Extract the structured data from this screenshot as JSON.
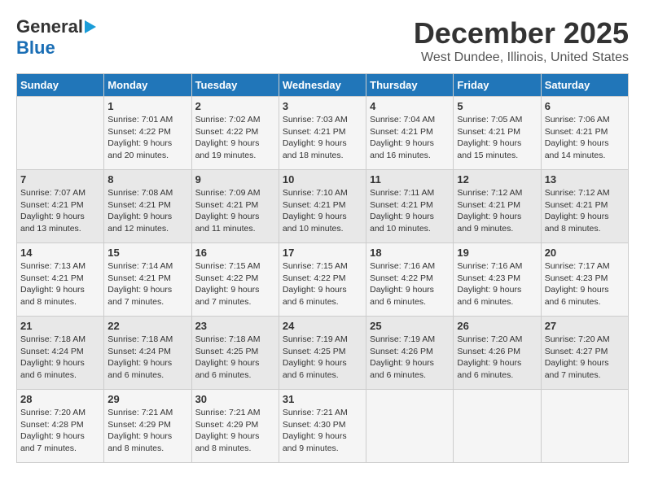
{
  "header": {
    "logo_general": "General",
    "logo_blue": "Blue",
    "month": "December 2025",
    "location": "West Dundee, Illinois, United States"
  },
  "weekdays": [
    "Sunday",
    "Monday",
    "Tuesday",
    "Wednesday",
    "Thursday",
    "Friday",
    "Saturday"
  ],
  "weeks": [
    [
      {
        "day": "",
        "info": ""
      },
      {
        "day": "1",
        "info": "Sunrise: 7:01 AM\nSunset: 4:22 PM\nDaylight: 9 hours\nand 20 minutes."
      },
      {
        "day": "2",
        "info": "Sunrise: 7:02 AM\nSunset: 4:22 PM\nDaylight: 9 hours\nand 19 minutes."
      },
      {
        "day": "3",
        "info": "Sunrise: 7:03 AM\nSunset: 4:21 PM\nDaylight: 9 hours\nand 18 minutes."
      },
      {
        "day": "4",
        "info": "Sunrise: 7:04 AM\nSunset: 4:21 PM\nDaylight: 9 hours\nand 16 minutes."
      },
      {
        "day": "5",
        "info": "Sunrise: 7:05 AM\nSunset: 4:21 PM\nDaylight: 9 hours\nand 15 minutes."
      },
      {
        "day": "6",
        "info": "Sunrise: 7:06 AM\nSunset: 4:21 PM\nDaylight: 9 hours\nand 14 minutes."
      }
    ],
    [
      {
        "day": "7",
        "info": "Sunrise: 7:07 AM\nSunset: 4:21 PM\nDaylight: 9 hours\nand 13 minutes."
      },
      {
        "day": "8",
        "info": "Sunrise: 7:08 AM\nSunset: 4:21 PM\nDaylight: 9 hours\nand 12 minutes."
      },
      {
        "day": "9",
        "info": "Sunrise: 7:09 AM\nSunset: 4:21 PM\nDaylight: 9 hours\nand 11 minutes."
      },
      {
        "day": "10",
        "info": "Sunrise: 7:10 AM\nSunset: 4:21 PM\nDaylight: 9 hours\nand 10 minutes."
      },
      {
        "day": "11",
        "info": "Sunrise: 7:11 AM\nSunset: 4:21 PM\nDaylight: 9 hours\nand 10 minutes."
      },
      {
        "day": "12",
        "info": "Sunrise: 7:12 AM\nSunset: 4:21 PM\nDaylight: 9 hours\nand 9 minutes."
      },
      {
        "day": "13",
        "info": "Sunrise: 7:12 AM\nSunset: 4:21 PM\nDaylight: 9 hours\nand 8 minutes."
      }
    ],
    [
      {
        "day": "14",
        "info": "Sunrise: 7:13 AM\nSunset: 4:21 PM\nDaylight: 9 hours\nand 8 minutes."
      },
      {
        "day": "15",
        "info": "Sunrise: 7:14 AM\nSunset: 4:21 PM\nDaylight: 9 hours\nand 7 minutes."
      },
      {
        "day": "16",
        "info": "Sunrise: 7:15 AM\nSunset: 4:22 PM\nDaylight: 9 hours\nand 7 minutes."
      },
      {
        "day": "17",
        "info": "Sunrise: 7:15 AM\nSunset: 4:22 PM\nDaylight: 9 hours\nand 6 minutes."
      },
      {
        "day": "18",
        "info": "Sunrise: 7:16 AM\nSunset: 4:22 PM\nDaylight: 9 hours\nand 6 minutes."
      },
      {
        "day": "19",
        "info": "Sunrise: 7:16 AM\nSunset: 4:23 PM\nDaylight: 9 hours\nand 6 minutes."
      },
      {
        "day": "20",
        "info": "Sunrise: 7:17 AM\nSunset: 4:23 PM\nDaylight: 9 hours\nand 6 minutes."
      }
    ],
    [
      {
        "day": "21",
        "info": "Sunrise: 7:18 AM\nSunset: 4:24 PM\nDaylight: 9 hours\nand 6 minutes."
      },
      {
        "day": "22",
        "info": "Sunrise: 7:18 AM\nSunset: 4:24 PM\nDaylight: 9 hours\nand 6 minutes."
      },
      {
        "day": "23",
        "info": "Sunrise: 7:18 AM\nSunset: 4:25 PM\nDaylight: 9 hours\nand 6 minutes."
      },
      {
        "day": "24",
        "info": "Sunrise: 7:19 AM\nSunset: 4:25 PM\nDaylight: 9 hours\nand 6 minutes."
      },
      {
        "day": "25",
        "info": "Sunrise: 7:19 AM\nSunset: 4:26 PM\nDaylight: 9 hours\nand 6 minutes."
      },
      {
        "day": "26",
        "info": "Sunrise: 7:20 AM\nSunset: 4:26 PM\nDaylight: 9 hours\nand 6 minutes."
      },
      {
        "day": "27",
        "info": "Sunrise: 7:20 AM\nSunset: 4:27 PM\nDaylight: 9 hours\nand 7 minutes."
      }
    ],
    [
      {
        "day": "28",
        "info": "Sunrise: 7:20 AM\nSunset: 4:28 PM\nDaylight: 9 hours\nand 7 minutes."
      },
      {
        "day": "29",
        "info": "Sunrise: 7:21 AM\nSunset: 4:29 PM\nDaylight: 9 hours\nand 8 minutes."
      },
      {
        "day": "30",
        "info": "Sunrise: 7:21 AM\nSunset: 4:29 PM\nDaylight: 9 hours\nand 8 minutes."
      },
      {
        "day": "31",
        "info": "Sunrise: 7:21 AM\nSunset: 4:30 PM\nDaylight: 9 hours\nand 9 minutes."
      },
      {
        "day": "",
        "info": ""
      },
      {
        "day": "",
        "info": ""
      },
      {
        "day": "",
        "info": ""
      }
    ]
  ]
}
